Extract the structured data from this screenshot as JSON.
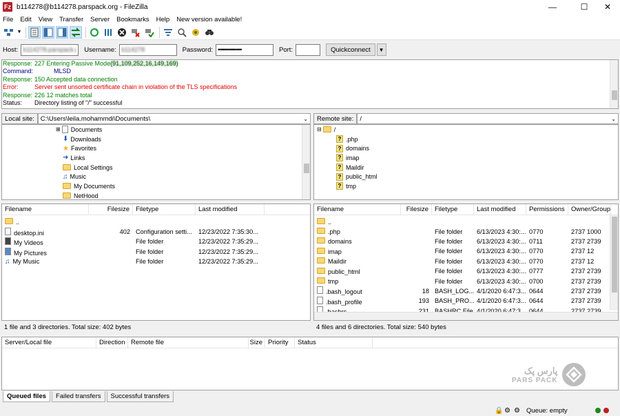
{
  "window": {
    "title": "b114278@b114278.parspack.org - FileZilla",
    "app_icon": "Fz"
  },
  "menu": [
    "File",
    "Edit",
    "View",
    "Transfer",
    "Server",
    "Bookmarks",
    "Help",
    "New version available!"
  ],
  "quickconnect": {
    "host_label": "Host:",
    "host_value": "b114278.parspack.c",
    "user_label": "Username:",
    "user_value": "b114278",
    "pass_label": "Password:",
    "pass_value": "••••••••••••••••",
    "port_label": "Port:",
    "port_value": "",
    "button": "Quickconnect"
  },
  "log": [
    {
      "k": "Response:",
      "v": "227 Entering Passive Mode ",
      "blur": "(91,109,252,16,149,169)",
      "c": "green"
    },
    {
      "k": "Command:",
      "v": "MLSD",
      "c": "blue"
    },
    {
      "k": "Response:",
      "v": "150 Accepted data connection",
      "c": "green"
    },
    {
      "k": "Error:",
      "v": "Server sent unsorted certificate chain in violation of the TLS specifications",
      "c": "red"
    },
    {
      "k": "Response:",
      "v": "226 12 matches total",
      "c": "green"
    },
    {
      "k": "Status:",
      "v": "Directory listing of \"/\" successful",
      "c": "black"
    }
  ],
  "local": {
    "site_label": "Local site:",
    "path": "C:\\Users\\leila.mohammdi\\Documents\\",
    "tree": [
      "Documents",
      "Downloads",
      "Favorites",
      "Links",
      "Local Settings",
      "Music",
      "My Documents",
      "NetHood"
    ],
    "headers": [
      "Filename",
      "Filesize",
      "Filetype",
      "Last modified"
    ],
    "files": [
      {
        "name": "..",
        "size": "",
        "type": "",
        "mod": ""
      },
      {
        "name": "desktop.ini",
        "size": "402",
        "type": "Configuration setti...",
        "mod": "12/23/2022 7:35:30..."
      },
      {
        "name": "My Videos",
        "size": "",
        "type": "File folder",
        "mod": "12/23/2022 7:35:29..."
      },
      {
        "name": "My Pictures",
        "size": "",
        "type": "File folder",
        "mod": "12/23/2022 7:35:29..."
      },
      {
        "name": "My Music",
        "size": "",
        "type": "File folder",
        "mod": "12/23/2022 7:35:29..."
      }
    ],
    "status": "1 file and 3 directories. Total size: 402 bytes"
  },
  "remote": {
    "site_label": "Remote site:",
    "path": "/",
    "tree_root": "/",
    "tree": [
      ".php",
      "domains",
      "imap",
      "Maildir",
      "public_html",
      "tmp"
    ],
    "headers": [
      "Filename",
      "Filesize",
      "Filetype",
      "Last modified",
      "Permissions",
      "Owner/Group"
    ],
    "files": [
      {
        "name": "..",
        "size": "",
        "type": "",
        "mod": "",
        "perm": "",
        "owner": ""
      },
      {
        "name": ".php",
        "size": "",
        "type": "File folder",
        "mod": "6/13/2023 4:30:...",
        "perm": "0770",
        "owner": "2737 1000"
      },
      {
        "name": "domains",
        "size": "",
        "type": "File folder",
        "mod": "6/13/2023 4:30:...",
        "perm": "0711",
        "owner": "2737 2739"
      },
      {
        "name": "imap",
        "size": "",
        "type": "File folder",
        "mod": "6/13/2023 4:30:...",
        "perm": "0770",
        "owner": "2737 12"
      },
      {
        "name": "Maildir",
        "size": "",
        "type": "File folder",
        "mod": "6/13/2023 4:30:...",
        "perm": "0770",
        "owner": "2737 12"
      },
      {
        "name": "public_html",
        "size": "",
        "type": "File folder",
        "mod": "6/13/2023 4:30:...",
        "perm": "0777",
        "owner": "2737 2739"
      },
      {
        "name": "tmp",
        "size": "",
        "type": "File folder",
        "mod": "6/13/2023 4:30:...",
        "perm": "0700",
        "owner": "2737 2739"
      },
      {
        "name": ".bash_logout",
        "size": "18",
        "type": "BASH_LOG...",
        "mod": "4/1/2020 6:47:3...",
        "perm": "0644",
        "owner": "2737 2739"
      },
      {
        "name": ".bash_profile",
        "size": "193",
        "type": "BASH_PRO...",
        "mod": "4/1/2020 6:47:3...",
        "perm": "0644",
        "owner": "2737 2739"
      },
      {
        "name": ".bashrc",
        "size": "231",
        "type": "BASHRC File",
        "mod": "4/1/2020 6:47:3...",
        "perm": "0644",
        "owner": "2737 2739"
      }
    ],
    "status": "4 files and 6 directories. Total size: 540 bytes"
  },
  "queue": {
    "headers": [
      "Server/Local file",
      "Direction",
      "Remote file",
      "Size",
      "Priority",
      "Status"
    ]
  },
  "tabs": [
    "Queued files",
    "Failed transfers",
    "Successful transfers"
  ],
  "bottom": {
    "queue": "Queue: empty"
  },
  "logo": {
    "fa": "پارس پک",
    "en": "PARS PACK"
  }
}
